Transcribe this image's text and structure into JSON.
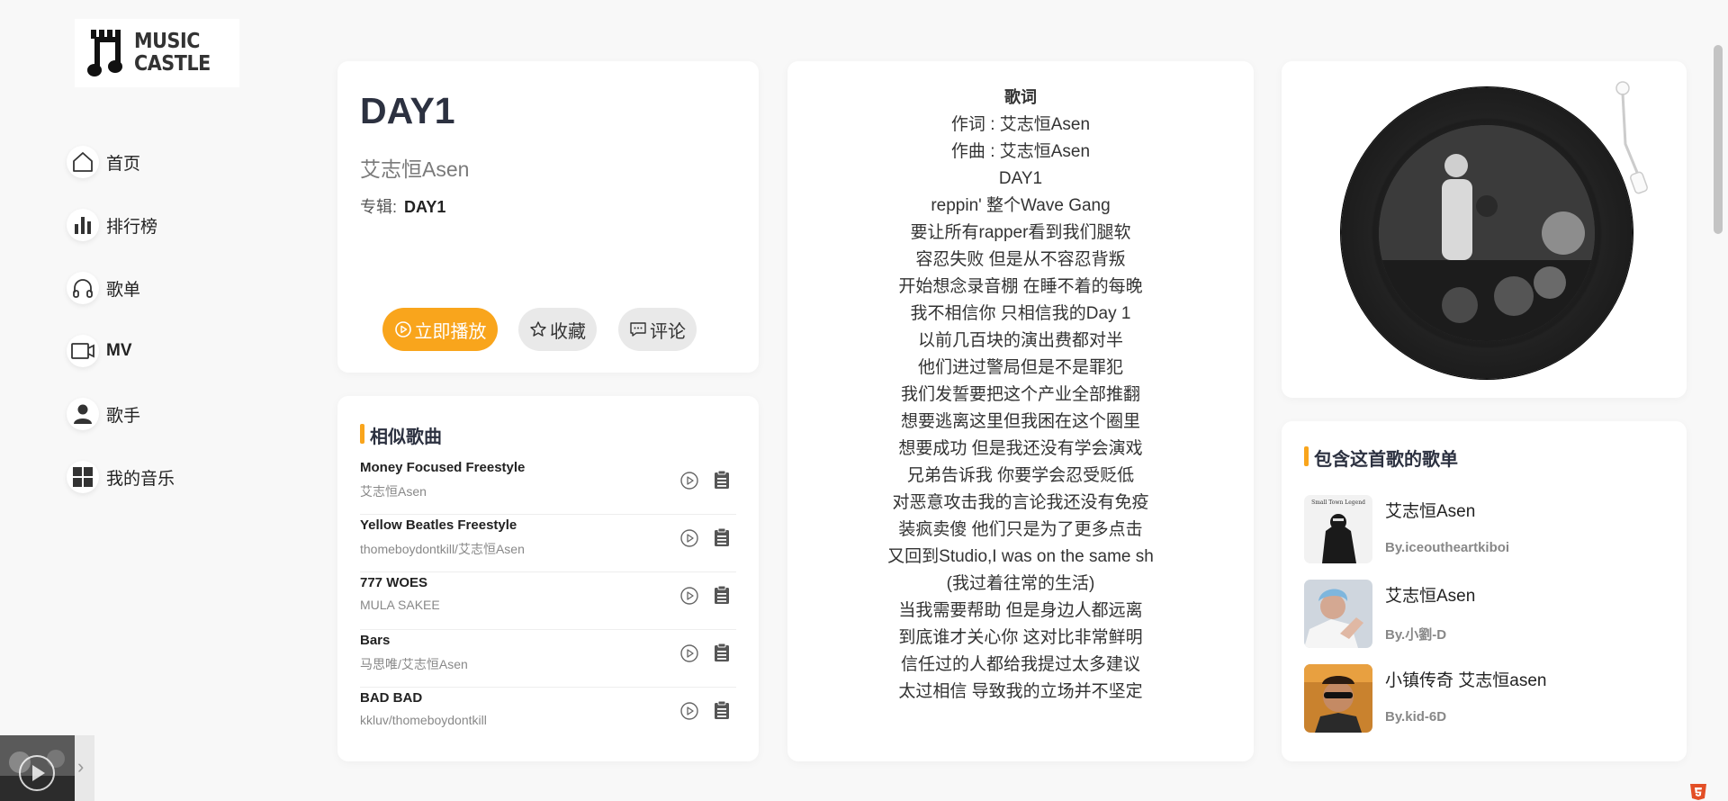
{
  "brand": {
    "line1": "MUSIC",
    "line2": "CASTLE"
  },
  "nav": [
    {
      "label": "首页",
      "icon": "home-icon"
    },
    {
      "label": "排行榜",
      "icon": "chart-icon"
    },
    {
      "label": "歌单",
      "icon": "headphones-icon"
    },
    {
      "label": "MV",
      "icon": "video-icon"
    },
    {
      "label": "歌手",
      "icon": "person-icon"
    },
    {
      "label": "我的音乐",
      "icon": "grid-icon"
    }
  ],
  "song": {
    "title": "DAY1",
    "artist": "艾志恒Asen",
    "album_label": "专辑:",
    "album": "DAY1",
    "play_label": "立即播放",
    "fav_label": "收藏",
    "comment_label": "评论"
  },
  "similar": {
    "title": "相似歌曲",
    "items": [
      {
        "name": "Money Focused Freestyle",
        "artist": "艾志恒Asen"
      },
      {
        "name": "Yellow Beatles Freestyle",
        "artist": "thomeboydontkill/艾志恒Asen"
      },
      {
        "name": "777 WOES",
        "artist": "MULA SAKEE"
      },
      {
        "name": "Bars",
        "artist": "马思唯/艾志恒Asen"
      },
      {
        "name": "BAD BAD",
        "artist": "kkluv/thomeboydontkill"
      }
    ]
  },
  "lyrics": {
    "title": "歌词",
    "lines": [
      "作词 : 艾志恒Asen",
      "作曲 : 艾志恒Asen",
      "DAY1",
      "reppin' 整个Wave Gang",
      "要让所有rapper看到我们腿软",
      "容忍失败 但是从不容忍背叛",
      "开始想念录音棚 在睡不着的每晚",
      "我不相信你 只相信我的Day 1",
      "以前几百块的演出费都对半",
      "他们进过警局但是不是罪犯",
      "我们发誓要把这个产业全部推翻",
      "想要逃离这里但我困在这个圈里",
      "想要成功 但是我还没有学会演戏",
      "兄弟告诉我 你要学会忍受贬低",
      "对恶意攻击我的言论我还没有免疫",
      "装疯卖傻 他们只是为了更多点击",
      "又回到Studio,I was on the same sh",
      "(我过着往常的生活)",
      "当我需要帮助 但是身边人都远离",
      "到底谁才关心你 这对比非常鲜明",
      "信任过的人都给我提过太多建议",
      "太过相信 导致我的立场并不坚定"
    ]
  },
  "playlists": {
    "title": "包含这首歌的歌单",
    "items": [
      {
        "name": "艾志恒Asen",
        "by": "By.iceoutheartkiboi",
        "cover_text": "Small Town Legend"
      },
      {
        "name": "艾志恒Asen",
        "by": "By.小劉-D",
        "cover_text": ""
      },
      {
        "name": "小镇传奇 艾志恒asen",
        "by": "By.kid-6D",
        "cover_text": ""
      }
    ]
  }
}
